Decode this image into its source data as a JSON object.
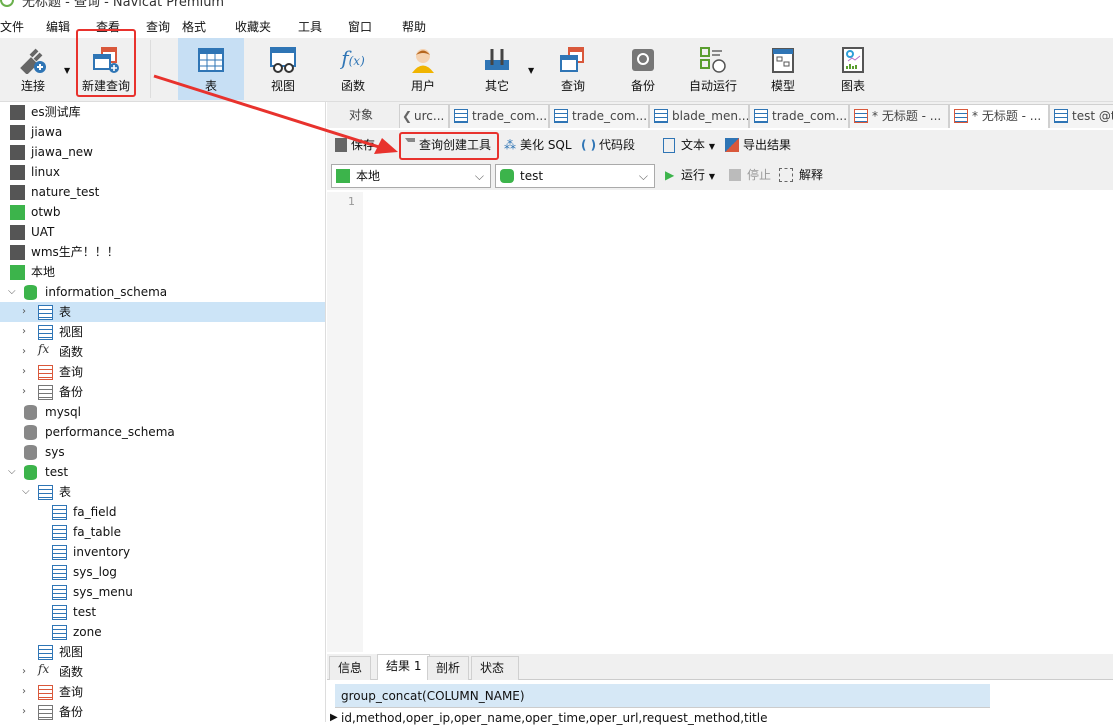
{
  "window": {
    "title": "无标题 - 查询 - Navicat Premium"
  },
  "menu": [
    "文件",
    "编辑",
    "查看",
    "查询",
    "格式",
    "收藏夹",
    "工具",
    "窗口",
    "帮助"
  ],
  "toolbar": [
    {
      "label": "连接",
      "icon": "connection-plug-icon"
    },
    {
      "label": "新建查询",
      "icon": "new-query-icon",
      "highlighted": true
    },
    {
      "label": "表",
      "icon": "table-icon",
      "active": true
    },
    {
      "label": "视图",
      "icon": "view-icon"
    },
    {
      "label": "函数",
      "icon": "function-icon"
    },
    {
      "label": "用户",
      "icon": "user-icon"
    },
    {
      "label": "其它",
      "icon": "tools-icon"
    },
    {
      "label": "查询",
      "icon": "query-icon"
    },
    {
      "label": "备份",
      "icon": "backup-icon"
    },
    {
      "label": "自动运行",
      "icon": "schedule-icon"
    },
    {
      "label": "模型",
      "icon": "model-icon"
    },
    {
      "label": "图表",
      "icon": "chart-icon"
    }
  ],
  "sidebar": {
    "items": [
      {
        "label": "es测试库",
        "type": "conn",
        "level": 0
      },
      {
        "label": "jiawa",
        "type": "conn",
        "level": 0
      },
      {
        "label": "jiawa_new",
        "type": "conn",
        "level": 0
      },
      {
        "label": "linux",
        "type": "conn",
        "level": 0
      },
      {
        "label": "nature_test",
        "type": "conn",
        "level": 0
      },
      {
        "label": "otwb",
        "type": "conn-green",
        "level": 0
      },
      {
        "label": "UAT",
        "type": "conn",
        "level": 0
      },
      {
        "label": "wms生产！！！",
        "type": "conn",
        "level": 0
      },
      {
        "label": "本地",
        "type": "conn-green",
        "level": 0,
        "expanded": true
      },
      {
        "label": "information_schema",
        "type": "db-green",
        "level": 1,
        "expanded": true
      },
      {
        "label": "表",
        "type": "table",
        "level": 2,
        "collapsed": true,
        "selected": true
      },
      {
        "label": "视图",
        "type": "view",
        "level": 2,
        "collapsed": true
      },
      {
        "label": "函数",
        "type": "func",
        "level": 2,
        "collapsed": true
      },
      {
        "label": "查询",
        "type": "query",
        "level": 2,
        "collapsed": true
      },
      {
        "label": "备份",
        "type": "backup",
        "level": 2,
        "collapsed": true
      },
      {
        "label": "mysql",
        "type": "db",
        "level": 1
      },
      {
        "label": "performance_schema",
        "type": "db",
        "level": 1
      },
      {
        "label": "sys",
        "type": "db",
        "level": 1
      },
      {
        "label": "test",
        "type": "db-green",
        "level": 1,
        "expanded": true
      },
      {
        "label": "表",
        "type": "table",
        "level": 2,
        "expanded": true
      },
      {
        "label": "fa_field",
        "type": "table",
        "level": 3
      },
      {
        "label": "fa_table",
        "type": "table",
        "level": 3
      },
      {
        "label": "inventory",
        "type": "table",
        "level": 3
      },
      {
        "label": "sys_log",
        "type": "table",
        "level": 3
      },
      {
        "label": "sys_menu",
        "type": "table",
        "level": 3
      },
      {
        "label": "test",
        "type": "table",
        "level": 3
      },
      {
        "label": "zone",
        "type": "table",
        "level": 3
      },
      {
        "label": "视图",
        "type": "view",
        "level": 2
      },
      {
        "label": "函数",
        "type": "func",
        "level": 2,
        "collapsed": true
      },
      {
        "label": "查询",
        "type": "query",
        "level": 2,
        "collapsed": true
      },
      {
        "label": "备份",
        "type": "backup",
        "level": 2,
        "collapsed": true
      }
    ]
  },
  "tabs": {
    "objects": "对象",
    "items": [
      "urc...",
      "trade_com...",
      "trade_com...",
      "blade_men...",
      "trade_com...",
      "* 无标题 - ...",
      "* 无标题 - ...",
      "test @t"
    ],
    "current": 6
  },
  "query_toolbar": {
    "save": "保存",
    "query_builder": "查询创建工具",
    "beautify": "美化 SQL",
    "snippet": "代码段",
    "text": "文本",
    "export": "导出结果",
    "connection": "本地",
    "database": "test",
    "run": "运行",
    "stop": "停止",
    "explain": "解释"
  },
  "editor": {
    "line_numbers": [
      "1"
    ]
  },
  "result": {
    "tabs": [
      "信息",
      "结果 1",
      "剖析",
      "状态"
    ],
    "current": 1,
    "columns": [
      "group_concat(COLUMN_NAME)"
    ],
    "rows": [
      [
        "id,method,oper_ip,oper_name,oper_time,oper_url,request_method,title"
      ]
    ]
  },
  "colors": {
    "accent": "#2f75b5",
    "highlight": "#e8322d",
    "selected": "#cce4f7"
  }
}
